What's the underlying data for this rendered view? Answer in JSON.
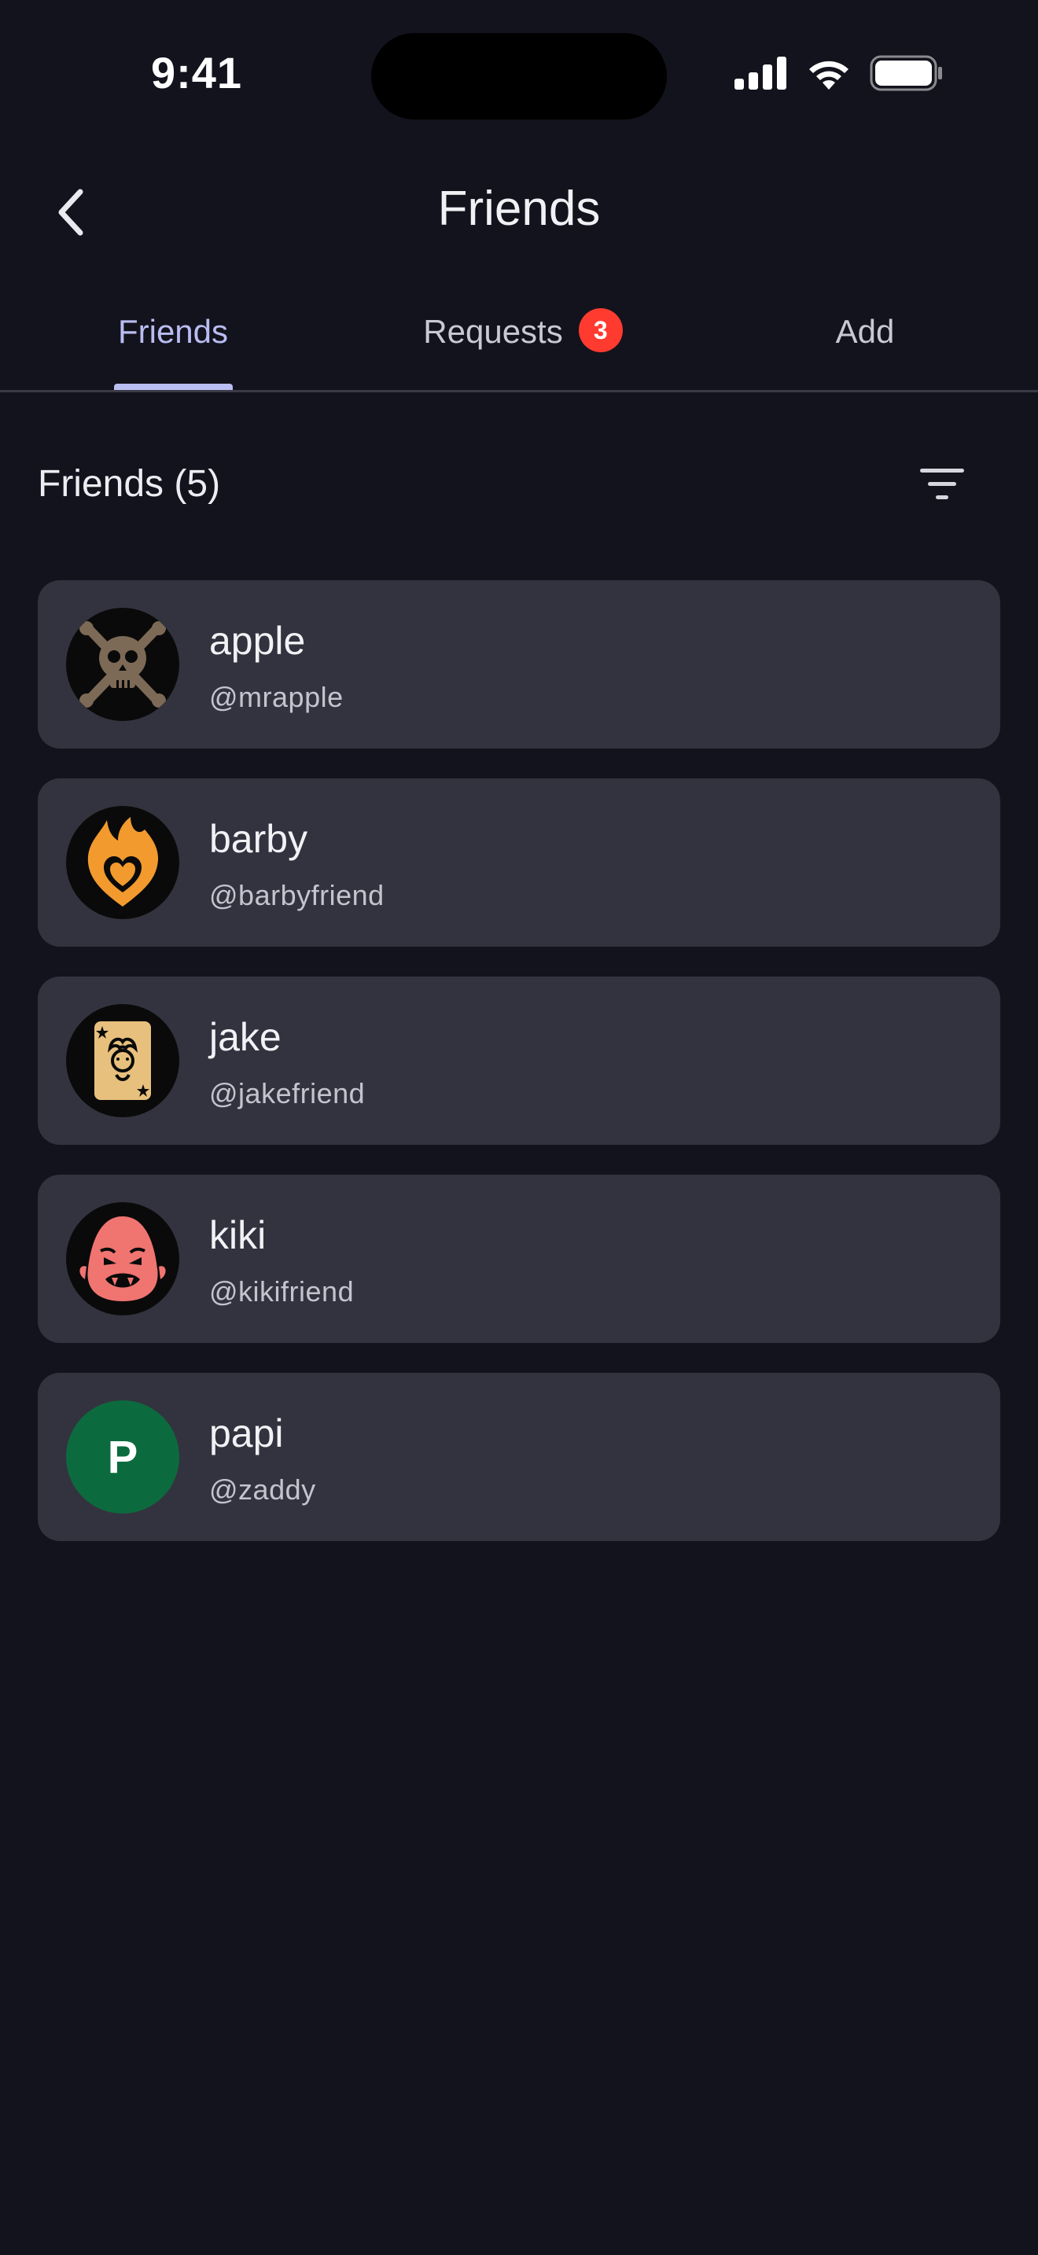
{
  "status_bar": {
    "time": "9:41"
  },
  "header": {
    "title": "Friends",
    "back_icon": "chevron-left-icon"
  },
  "tabs": [
    {
      "label": "Friends",
      "active": true
    },
    {
      "label": "Requests",
      "active": false,
      "badge": "3"
    },
    {
      "label": "Add",
      "active": false
    }
  ],
  "section": {
    "title": "Friends (5)",
    "filter_icon": "filter-icon"
  },
  "friends": [
    {
      "name": "apple",
      "handle": "@mrapple",
      "avatar": "skull-crossbones-icon"
    },
    {
      "name": "barby",
      "handle": "@barbyfriend",
      "avatar": "flaming-heart-icon"
    },
    {
      "name": "jake",
      "handle": "@jakefriend",
      "avatar": "joker-card-icon"
    },
    {
      "name": "kiki",
      "handle": "@kikifriend",
      "avatar": "ogre-face-icon"
    },
    {
      "name": "papi",
      "handle": "@zaddy",
      "avatar_letter": "P"
    }
  ],
  "colors": {
    "background": "#13131d",
    "card": "#33333f",
    "accent": "#b9bdf2",
    "badge": "#ff3b30",
    "avatar_green": "#0c6b3e"
  }
}
